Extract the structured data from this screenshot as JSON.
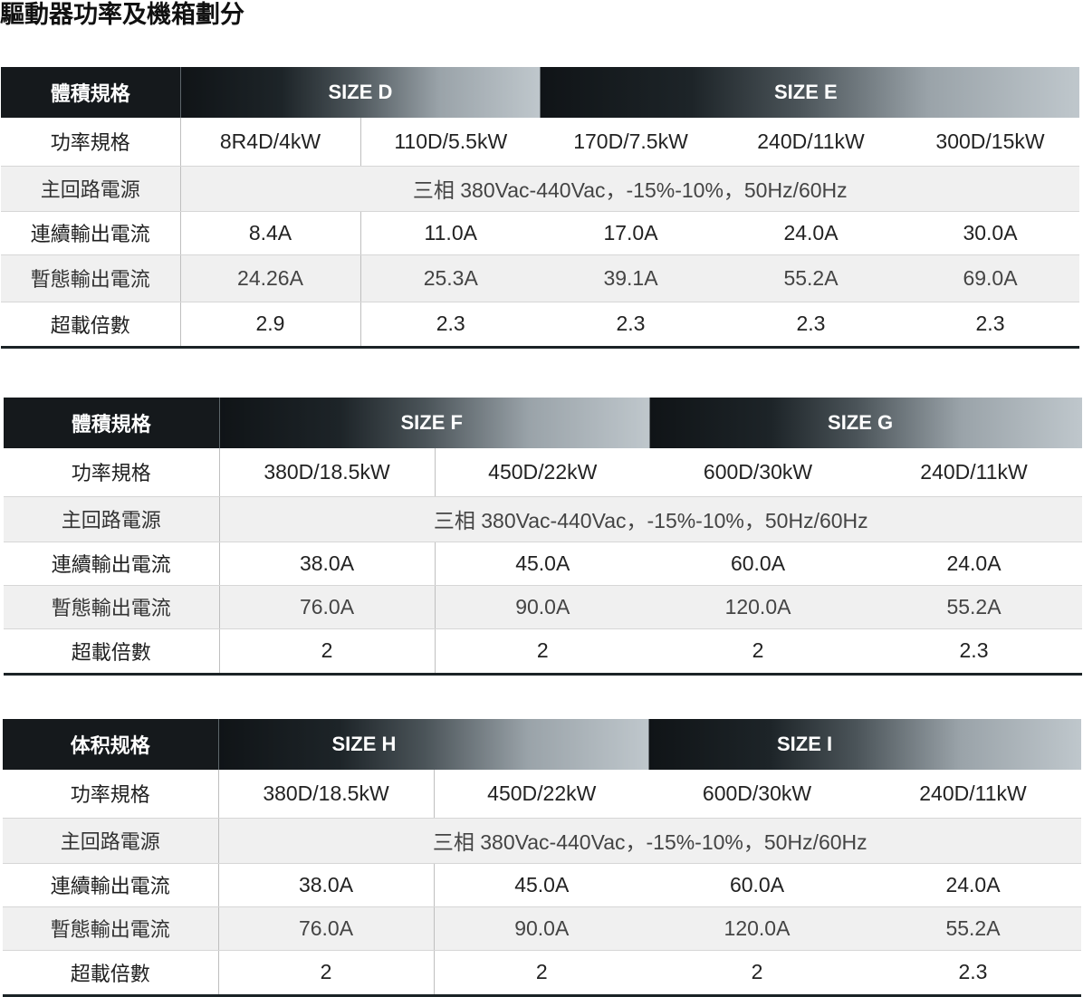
{
  "page": {
    "title": "驅動器功率及機箱劃分"
  },
  "tables": [
    {
      "corner_label": "體積規格",
      "sizes": [
        "SIZE D",
        "SIZE E"
      ],
      "rows": {
        "power": {
          "label": "功率規格",
          "values": [
            "8R4D/4kW",
            "110D/5.5kW",
            "170D/7.5kW",
            "240D/11kW",
            "300D/15kW"
          ]
        },
        "supply": {
          "label": "主回路電源",
          "value": "三相 380Vac-440Vac，-15%-10%，50Hz/60Hz"
        },
        "continuous": {
          "label": "連續輸出電流",
          "values": [
            "8.4A",
            "11.0A",
            "17.0A",
            "24.0A",
            "30.0A"
          ]
        },
        "transient": {
          "label": "暫態輸出電流",
          "values": [
            "24.26A",
            "25.3A",
            "39.1A",
            "55.2A",
            "69.0A"
          ]
        },
        "overload": {
          "label": "超載倍數",
          "values": [
            "2.9",
            "2.3",
            "2.3",
            "2.3",
            "2.3"
          ]
        }
      }
    },
    {
      "corner_label": "體積規格",
      "sizes": [
        "SIZE F",
        "SIZE G"
      ],
      "rows": {
        "power": {
          "label": "功率規格",
          "values": [
            "380D/18.5kW",
            "450D/22kW",
            "600D/30kW",
            "240D/11kW"
          ]
        },
        "supply": {
          "label": "主回路電源",
          "value": "三相 380Vac-440Vac，-15%-10%，50Hz/60Hz"
        },
        "continuous": {
          "label": "連續輸出電流",
          "values": [
            "38.0A",
            "45.0A",
            "60.0A",
            "24.0A"
          ]
        },
        "transient": {
          "label": "暫態輸出電流",
          "values": [
            "76.0A",
            "90.0A",
            "120.0A",
            "55.2A"
          ]
        },
        "overload": {
          "label": "超載倍數",
          "values": [
            "2",
            "2",
            "2",
            "2.3"
          ]
        }
      }
    },
    {
      "corner_label": "体积规格",
      "sizes": [
        "SIZE H",
        "SIZE I"
      ],
      "rows": {
        "power": {
          "label": "功率規格",
          "values": [
            "380D/18.5kW",
            "450D/22kW",
            "600D/30kW",
            "240D/11kW"
          ]
        },
        "supply": {
          "label": "主回路電源",
          "value": "三相 380Vac-440Vac，-15%-10%，50Hz/60Hz"
        },
        "continuous": {
          "label": "連續輸出電流",
          "values": [
            "38.0A",
            "45.0A",
            "60.0A",
            "24.0A"
          ]
        },
        "transient": {
          "label": "暫態輸出電流",
          "values": [
            "76.0A",
            "90.0A",
            "120.0A",
            "55.2A"
          ]
        },
        "overload": {
          "label": "超載倍數",
          "values": [
            "2",
            "2",
            "2",
            "2.3"
          ]
        }
      }
    }
  ]
}
